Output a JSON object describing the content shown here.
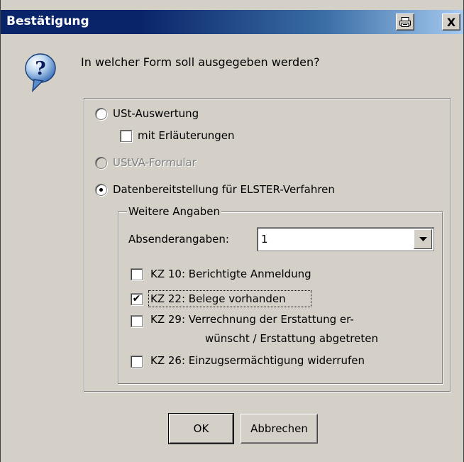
{
  "window": {
    "title": "Bestätigung",
    "print_button": "🖶",
    "close_button": "X"
  },
  "question": "In welcher Form soll ausgegeben werden?",
  "options": {
    "ust_auswertung": {
      "label": "USt-Auswertung",
      "selected": false
    },
    "mit_erlaeuterungen": {
      "label": "mit Erläuterungen",
      "checked": false
    },
    "ustva_formular": {
      "label": "UStVA-Formular",
      "enabled": false
    },
    "datenbereitstellung": {
      "label": "Datenbereitstellung für ELSTER-Verfahren",
      "selected": true
    }
  },
  "weitere": {
    "legend": "Weitere Angaben",
    "absender_label": "Absenderangaben:",
    "absender_value": "1",
    "kz10": {
      "label": "KZ 10: Berichtigte Anmeldung",
      "checked": false
    },
    "kz22": {
      "label": "KZ 22: Belege vorhanden",
      "checked": true
    },
    "kz29": {
      "label_line1": "KZ 29: Verrechnung der Erstattung er-",
      "label_line2": "wünscht / Erstattung abgetreten",
      "checked": false
    },
    "kz26": {
      "label": "KZ 26: Einzugsermächtigung widerrufen",
      "checked": false
    }
  },
  "buttons": {
    "ok": "OK",
    "cancel": "Abbrechen"
  },
  "check_mark": "✔"
}
